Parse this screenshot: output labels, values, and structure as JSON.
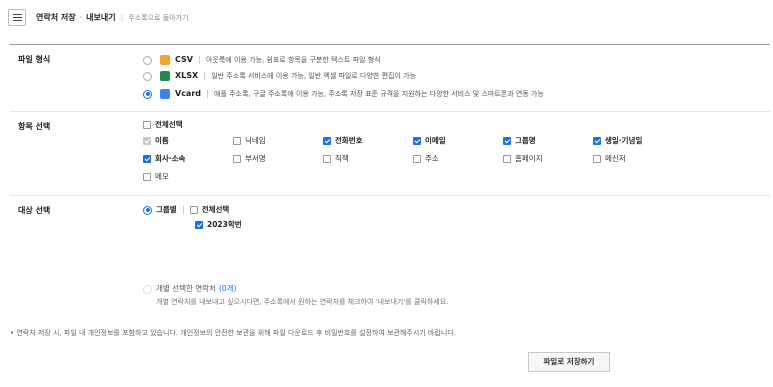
{
  "header": {
    "title": "연락처 저장",
    "subtitle": "내보내기",
    "back_link": "주소록으로 돌아가기"
  },
  "file_format": {
    "label": "파일 형식",
    "options": [
      {
        "name": "CSV",
        "desc": "아웃룩에 이용 가능, 쉼표로 항목을 구분한 텍스트 파일 형식",
        "selected": false,
        "icon": "csv-file-icon",
        "color": "#f2a62b"
      },
      {
        "name": "XLSX",
        "desc": "일반 주소록 서비스에 이용 가능, 일반 엑셀 파일로 다양한 편집이 가능",
        "selected": false,
        "icon": "excel-file-icon",
        "color": "#1f8a4c"
      },
      {
        "name": "Vcard",
        "desc": "애플 주소록, 구글 주소록에 이용 가능, 주소록 저장 표준 규격을 지원하는 다양한 서비스 및 스마트폰과 연동 가능",
        "selected": true,
        "icon": "vcard-file-icon",
        "color": "#3b82f6"
      }
    ]
  },
  "fields": {
    "label": "항목 선택",
    "select_all": "전체선택",
    "items": [
      {
        "label": "이름",
        "checked": true,
        "disabled": true
      },
      {
        "label": "닉네임",
        "checked": false
      },
      {
        "label": "전화번호",
        "checked": true
      },
      {
        "label": "이메일",
        "checked": true
      },
      {
        "label": "그룹명",
        "checked": true
      },
      {
        "label": "생일·기념일",
        "checked": true
      },
      {
        "label": "회사·소속",
        "checked": true
      },
      {
        "label": "부서명",
        "checked": false
      },
      {
        "label": "직책",
        "checked": false
      },
      {
        "label": "주소",
        "checked": false
      },
      {
        "label": "홈페이지",
        "checked": false
      },
      {
        "label": "메신저",
        "checked": false
      },
      {
        "label": "메모",
        "checked": false
      }
    ]
  },
  "target": {
    "label": "대상 선택",
    "by_group": "그룹별",
    "select_all": "전체선택",
    "groups": [
      {
        "label": "2023학번",
        "checked": true
      }
    ],
    "individual_label": "개별 선택한 연락처",
    "individual_count": "(0개)",
    "individual_hint": "개별 연락처를 내보내고 싶으시다면, 주소록에서 원하는 연락처를 체크하여 '내보내기'를 클릭하세요."
  },
  "notice": "• 연락처 저장 시, 파일 내 개인정보를 포함하고 있습니다. 개인정보의 안전한 보관을 위해 파일 다운로드 후 비밀번호를 설정하여 보관해주시기 바랍니다.",
  "save_button": "파일로 저장하기",
  "colors": {
    "accent": "#1a73e8",
    "csv": "#f2a62b",
    "xlsx": "#1f8a4c",
    "vcard": "#3b82f6"
  }
}
